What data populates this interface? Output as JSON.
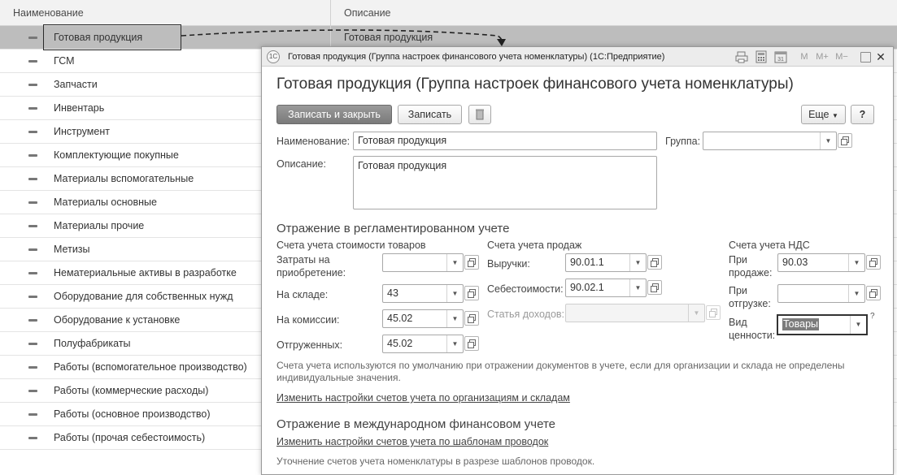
{
  "list": {
    "headers": {
      "name": "Наименование",
      "description": "Описание"
    },
    "rows": [
      {
        "name": "Готовая продукция",
        "description": "Готовая продукция"
      },
      {
        "name": "ГСМ"
      },
      {
        "name": "Запчасти"
      },
      {
        "name": "Инвентарь"
      },
      {
        "name": "Инструмент"
      },
      {
        "name": "Комплектующие покупные"
      },
      {
        "name": "Материалы вспомогательные"
      },
      {
        "name": "Материалы основные"
      },
      {
        "name": "Материалы прочие"
      },
      {
        "name": "Метизы"
      },
      {
        "name": "Нематериальные активы в разработке"
      },
      {
        "name": "Оборудование для собственных нужд"
      },
      {
        "name": "Оборудование к установке"
      },
      {
        "name": "Полуфабрикаты"
      },
      {
        "name": "Работы (вспомогательное производство)"
      },
      {
        "name": "Работы (коммерческие расходы)"
      },
      {
        "name": "Работы (основное производство)"
      },
      {
        "name": "Работы (прочая себестоимость)"
      }
    ]
  },
  "window": {
    "logo": "1С",
    "title": "Готовая продукция (Группа настроек финансового учета номенклатуры)  (1С:Предприятие)",
    "toolbar": {
      "m": "M",
      "mplus": "M+",
      "mminus": "M−",
      "close": "✕",
      "calendar_day": "31"
    },
    "form_title": "Готовая продукция (Группа настроек финансового учета номенклатуры)",
    "buttons": {
      "save_close": "Записать и закрыть",
      "save": "Записать",
      "more": "Еще",
      "help": "?"
    },
    "fields": {
      "name_label": "Наименование:",
      "name_value": "Готовая продукция",
      "group_label": "Группа:",
      "group_value": "",
      "desc_label": "Описание:",
      "desc_value": "Готовая продукция"
    },
    "reg": {
      "title": "Отражение в регламентированном учете",
      "cost_header": "Счета учета стоимости товаров",
      "acq_label": "Затраты на приобретение:",
      "acq_value": "",
      "warehouse_label": "На складе:",
      "warehouse_value": "43",
      "commission_label": "На комиссии:",
      "commission_value": "45.02",
      "shipped_label": "Отгруженных:",
      "shipped_value": "45.02",
      "sales_header": "Счета учета продаж",
      "revenue_label": "Выручки:",
      "revenue_value": "90.01.1",
      "cogs_label": "Себестоимости:",
      "cogs_value": "90.02.1",
      "income_label": "Статья доходов:",
      "income_value": "",
      "vat_header": "Счета учета НДС",
      "vat_sale_label": "При продаже:",
      "vat_sale_value": "90.03",
      "vat_ship_label": "При отгрузке:",
      "vat_ship_value": "",
      "value_kind_label": "Вид ценности:",
      "value_kind_value": "Товары",
      "value_kind_hint": "?",
      "note": "Счета учета используются по умолчанию при отражении документов в учете, если для организации и склада не определены индивидуальные значения.",
      "link": "Изменить настройки счетов учета по организациям и складам"
    },
    "intl": {
      "title": "Отражение в международном финансовом учете",
      "link": "Изменить настройки счетов учета по шаблонам проводок",
      "note": "Уточнение счетов учета номенклатуры в разрезе шаблонов проводок."
    }
  }
}
